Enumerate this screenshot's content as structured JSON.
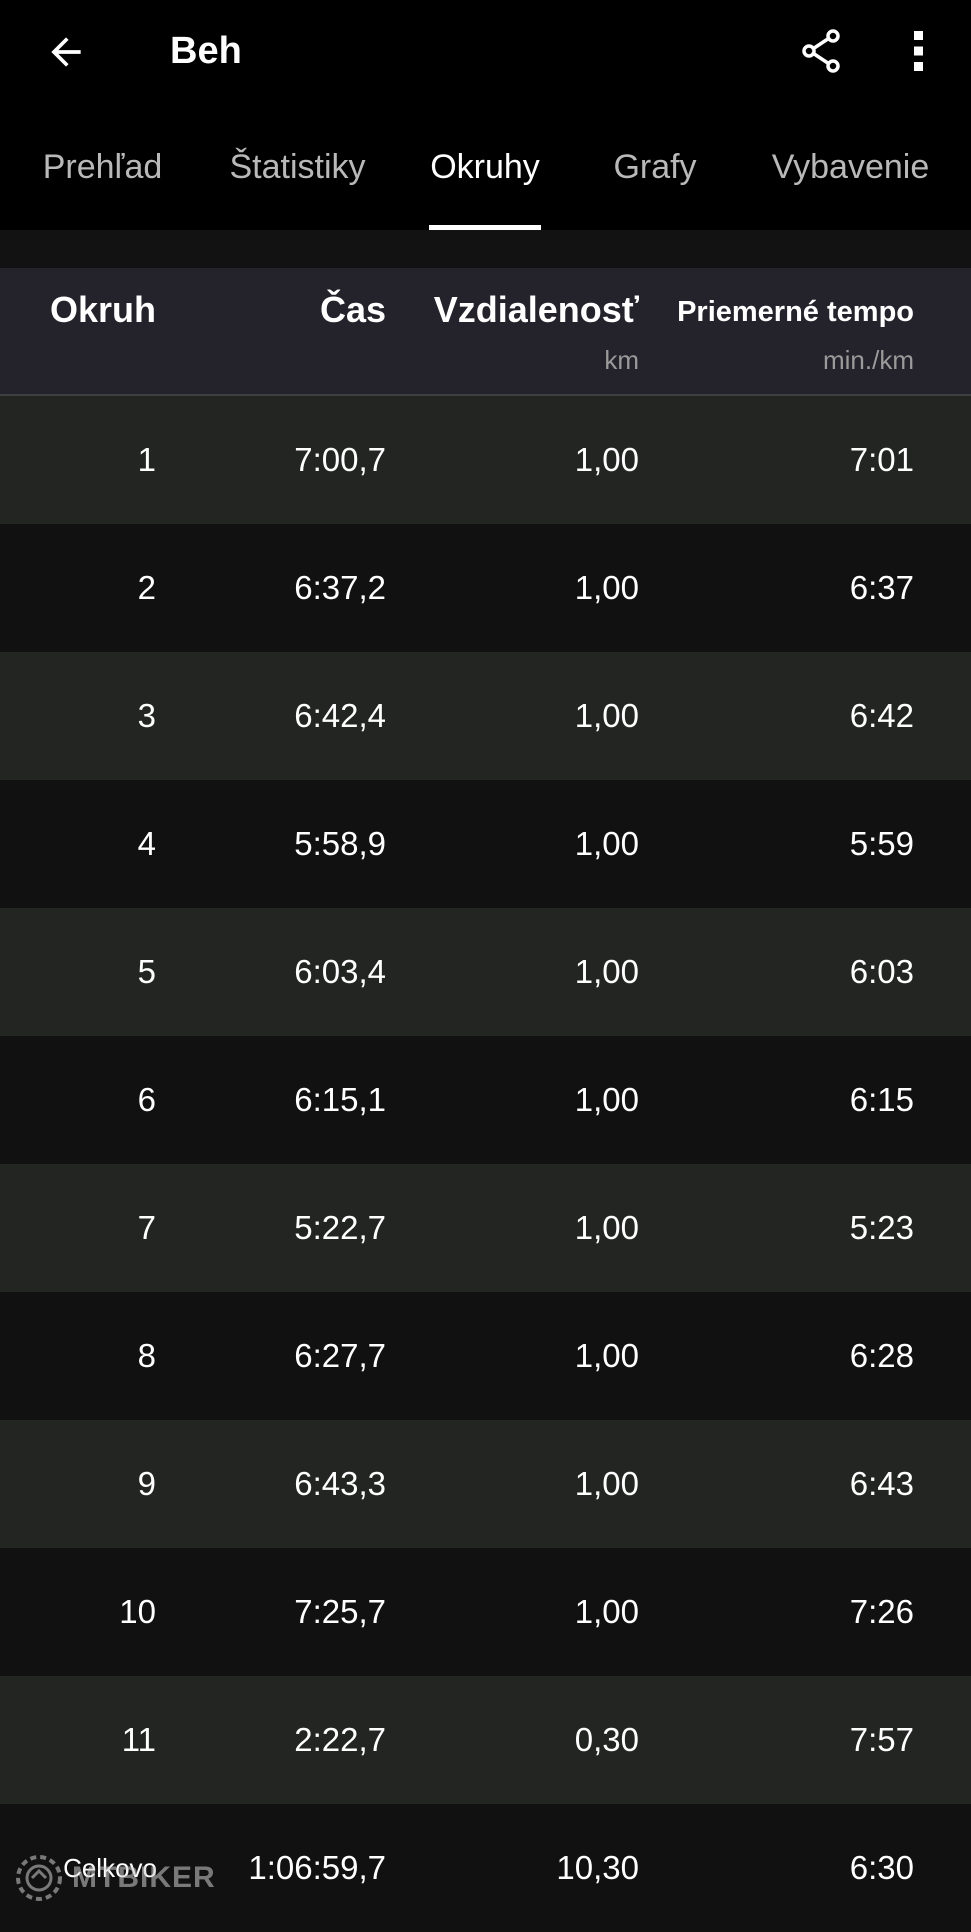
{
  "app_bar": {
    "title": "Beh",
    "back_icon": "arrow-left-icon",
    "share_icon": "share-icon",
    "more_icon": "more-vertical-icon"
  },
  "tabs": [
    {
      "label": "Prehľad",
      "active": false
    },
    {
      "label": "Štatistiky",
      "active": false
    },
    {
      "label": "Okruhy",
      "active": true
    },
    {
      "label": "Grafy",
      "active": false
    },
    {
      "label": "Vybavenie",
      "active": false
    }
  ],
  "table": {
    "columns": [
      {
        "label": "Okruh",
        "unit": ""
      },
      {
        "label": "Čas",
        "unit": ""
      },
      {
        "label": "Vzdialenosť",
        "unit": "km"
      },
      {
        "label": "Priemerné tempo",
        "unit": "min./km"
      }
    ],
    "rows": [
      [
        "1",
        "7:00,7",
        "1,00",
        "7:01"
      ],
      [
        "2",
        "6:37,2",
        "1,00",
        "6:37"
      ],
      [
        "3",
        "6:42,4",
        "1,00",
        "6:42"
      ],
      [
        "4",
        "5:58,9",
        "1,00",
        "5:59"
      ],
      [
        "5",
        "6:03,4",
        "1,00",
        "6:03"
      ],
      [
        "6",
        "6:15,1",
        "1,00",
        "6:15"
      ],
      [
        "7",
        "5:22,7",
        "1,00",
        "5:23"
      ],
      [
        "8",
        "6:27,7",
        "1,00",
        "6:28"
      ],
      [
        "9",
        "6:43,3",
        "1,00",
        "6:43"
      ],
      [
        "10",
        "7:25,7",
        "1,00",
        "7:26"
      ],
      [
        "11",
        "2:22,7",
        "0,30",
        "7:57"
      ]
    ],
    "total": [
      "Celkovo",
      "1:06:59,7",
      "10,30",
      "6:30"
    ]
  },
  "watermark": {
    "text": "MTBIKER",
    "icon": "gear-logo-icon"
  },
  "colors": {
    "background": "#000000",
    "row_light": "#232523",
    "row_dark": "#111111",
    "header_bg": "#24222a",
    "tab_inactive": "#b9b9b9",
    "text": "#ffffff"
  }
}
